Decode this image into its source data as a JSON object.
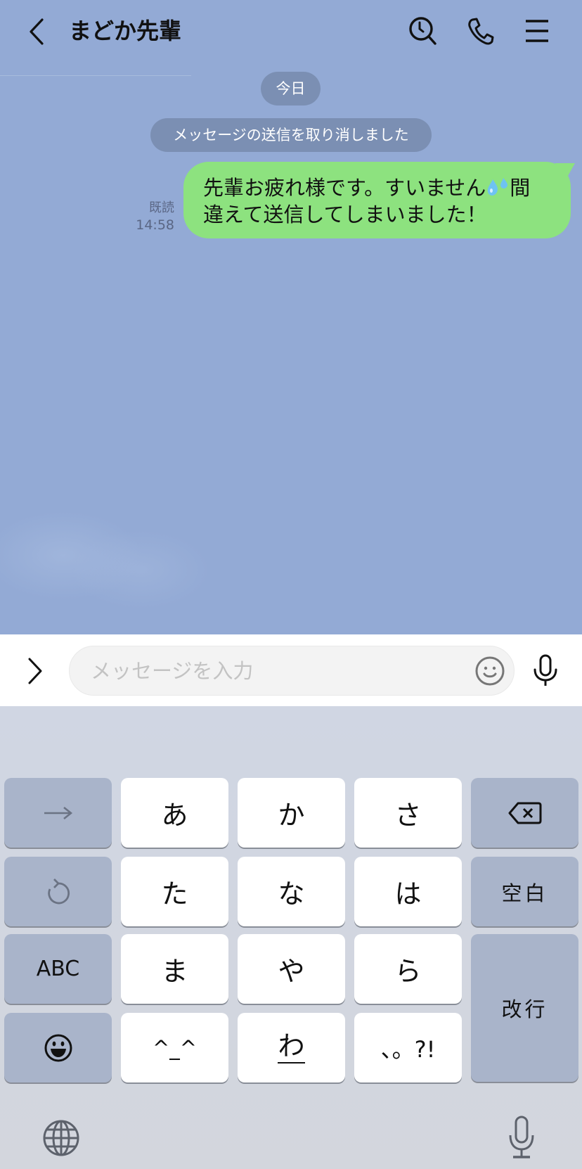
{
  "header": {
    "title": "まどか先輩",
    "icons": [
      "chevron-left-icon",
      "search-history-icon",
      "phone-icon",
      "menu-icon"
    ]
  },
  "chat": {
    "date_label": "今日",
    "system_message": "メッセージの送信を取り消しました",
    "messages": [
      {
        "direction": "sent",
        "line1_before_emoji": "先輩お疲れ様です。すいません",
        "emoji": "sweat-droplets",
        "line1_after_emoji": "間",
        "line2": "違えて送信してしまいました！",
        "read_label": "既読",
        "time": "14:58"
      }
    ],
    "colors": {
      "background": "#93aad5",
      "bubble": "#8de27f",
      "pill": "#7b8fb3"
    }
  },
  "input_bar": {
    "placeholder": "メッセージを入力",
    "value": ""
  },
  "keyboard": {
    "rows": [
      [
        "→",
        "あ",
        "か",
        "さ",
        "delete"
      ],
      [
        "undo",
        "た",
        "な",
        "は",
        "空白"
      ],
      [
        "ABC",
        "ま",
        "や",
        "ら",
        "改行"
      ],
      [
        "emoji",
        "^_^",
        "わ_",
        "、。?!"
      ]
    ],
    "keys": {
      "next": "→",
      "a": "あ",
      "ka": "か",
      "sa": "さ",
      "ta": "た",
      "na": "な",
      "ha": "は",
      "space": "空白",
      "abc": "ABC",
      "ma": "ま",
      "ya": "や",
      "ra": "ら",
      "return": "改行",
      "kaomoji": "^_^",
      "wa": "わ",
      "punct": "、。?!"
    }
  }
}
